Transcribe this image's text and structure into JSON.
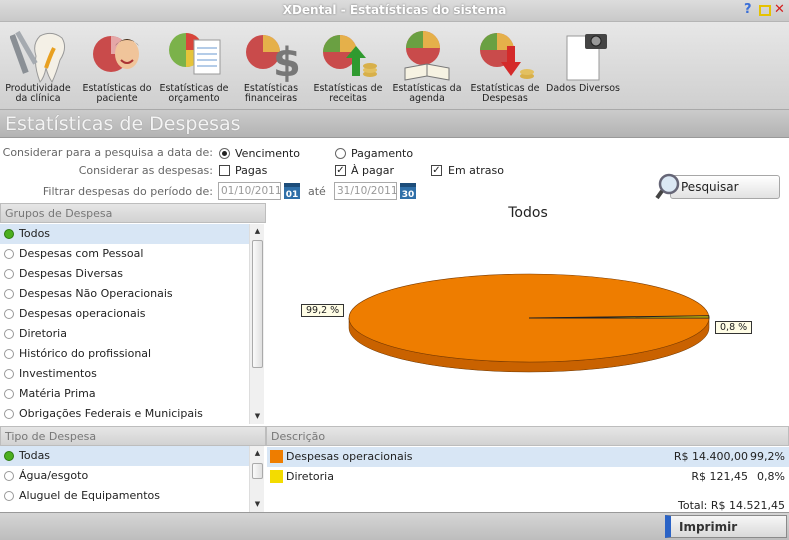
{
  "window": {
    "title": "XDental - Estatísticas do sistema"
  },
  "toolbar": {
    "buttons": [
      {
        "label": "Produtividade da clínica",
        "icon": "tooth-dental-tools-icon"
      },
      {
        "label": "Estatísticas do paciente",
        "icon": "pie-chart-person-icon"
      },
      {
        "label": "Estatísticas de orçamento",
        "icon": "pie-chart-document-icon"
      },
      {
        "label": "Estatísticas financeiras",
        "icon": "pie-chart-dollar-icon"
      },
      {
        "label": "Estatísticas de receitas",
        "icon": "pie-chart-arrow-up-icon"
      },
      {
        "label": "Estatísticas da agenda",
        "icon": "pie-chart-book-icon"
      },
      {
        "label": "Estatísticas de Despesas",
        "icon": "pie-chart-arrow-down-icon"
      },
      {
        "label": "Dados Diversos",
        "icon": "document-camera-icon"
      }
    ]
  },
  "section": {
    "title": "Estatísticas de Despesas"
  },
  "filters": {
    "data_label": "Considerar para a pesquisa a data de:",
    "data_options": [
      {
        "label": "Vencimento",
        "selected": true
      },
      {
        "label": "Pagamento",
        "selected": false
      }
    ],
    "despesas_label": "Considerar as despesas:",
    "despesas_options": [
      {
        "label": "Pagas",
        "checked": false
      },
      {
        "label": "À pagar",
        "checked": true
      },
      {
        "label": "Em atraso",
        "checked": true
      }
    ],
    "periodo_label": "Filtrar despesas do período de:",
    "date_from": "01/10/2011",
    "date_from_icon": "01",
    "ate": "até",
    "date_to": "31/10/2011",
    "date_to_icon": "30",
    "search_label": "Pesquisar"
  },
  "grupos": {
    "header": "Grupos de Despesa",
    "items": [
      "Todos",
      "Despesas com Pessoal",
      "Despesas Diversas",
      "Despesas Não Operacionais",
      "Despesas operacionais",
      "Diretoria",
      "Histórico do profissional",
      "Investimentos",
      "Matéria Prima",
      "Obrigações Federais e Municipais"
    ],
    "selected": 0
  },
  "tipos": {
    "header": "Tipo de Despesa",
    "items": [
      "Todas",
      "Água/esgoto",
      "Aluguel de Equipamentos"
    ],
    "selected": 0
  },
  "chart": {
    "title": "Todos",
    "label_big": "99,2 %",
    "label_small": "0,8 %"
  },
  "chart_data": {
    "type": "pie",
    "title": "Todos",
    "categories": [
      "Despesas operacionais",
      "Diretoria"
    ],
    "values": [
      99.2,
      0.8
    ],
    "colors": [
      "#ee7d00",
      "#f3dc00"
    ]
  },
  "descricao": {
    "header": "Descrição",
    "rows": [
      {
        "name": "Despesas operacionais",
        "value": "R$ 14.400,00",
        "pct": "99,2%",
        "color": "#ee7d00"
      },
      {
        "name": "Diretoria",
        "value": "R$ 121,45",
        "pct": "0,8%",
        "color": "#f3dc00"
      }
    ],
    "total": "Total: R$ 14.521,45"
  },
  "footer": {
    "print_label": "Imprimir"
  }
}
